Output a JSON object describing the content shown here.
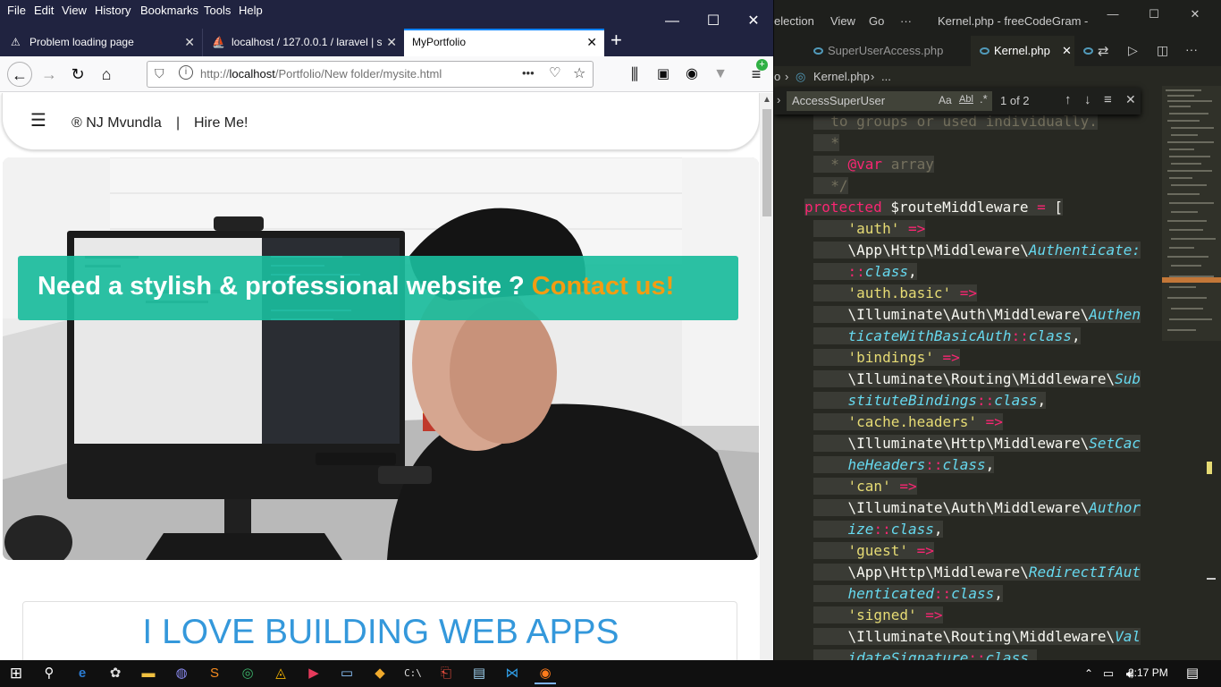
{
  "firefox": {
    "menu": [
      "File",
      "Edit",
      "View",
      "History",
      "Bookmarks",
      "Tools",
      "Help"
    ],
    "tabs": [
      {
        "label": "Problem loading page",
        "icon": "warning-icon"
      },
      {
        "label": "localhost / 127.0.0.1 / laravel | s",
        "icon": "phpmyadmin-icon"
      },
      {
        "label": "MyPortfolio",
        "active": true
      }
    ],
    "url_prefix": "http://",
    "url_host": "localhost",
    "url_path": "/Portfolio/New folder/mysite.html",
    "url_menu": "•••"
  },
  "site": {
    "brand": "® NJ Mvundla",
    "separator": "|",
    "hire": "Hire Me!",
    "banner_main": "Need a stylish & professional website ?",
    "banner_cta": "Contact us!",
    "heading": "I LOVE BUILDING WEB APPS"
  },
  "vscode": {
    "menu_partial": "election",
    "menu_view": "View",
    "menu_go": "Go",
    "menu_more": "···",
    "title": "Kernel.php - freeCodeGram - ...",
    "tabs": [
      {
        "label": "SuperUserAccess.php"
      },
      {
        "label": "Kernel.php",
        "active": true
      }
    ],
    "crumb_prefix": "o",
    "crumb_file": "Kernel.php",
    "crumb_more": "...",
    "find_query": "AccessSuperUser",
    "find_opt_case": "Aa",
    "find_opt_word": "Abl",
    "find_opt_regex": ".*",
    "find_count": "1 of 2",
    "code": [
      {
        "plain": "  to groups or used individually.",
        "cls": "c"
      },
      {
        "plain": "  *",
        "cls": "c"
      },
      {
        "plain": "  * ",
        "cls": "c",
        "kw": "@var",
        "rest": " array"
      },
      {
        "plain": "  */",
        "cls": "c"
      },
      {
        "kw": "protected",
        "rest": " $routeMiddleware",
        "op": " = ",
        "tail": "["
      },
      {
        "str": "    'auth'",
        "op": " =>"
      },
      {
        "ns": "    \\App\\Http\\Middleware\\",
        "it": "Authenticate:"
      },
      {
        "op2": "    ::",
        "cl": "class",
        "tail": ","
      },
      {
        "str": "    'auth.basic'",
        "op": " =>"
      },
      {
        "ns": "    \\Illuminate\\Auth\\Middleware\\",
        "it": "Authen"
      },
      {
        "it": "    ticateWithBasicAuth",
        "op2": "::",
        "cl": "class",
        "tail": ","
      },
      {
        "str": "    'bindings'",
        "op": " =>"
      },
      {
        "ns": "    \\Illuminate\\Routing\\Middleware\\",
        "it": "Sub"
      },
      {
        "it": "    stituteBindings",
        "op2": "::",
        "cl": "class",
        "tail": ","
      },
      {
        "str": "    'cache.headers'",
        "op": " =>"
      },
      {
        "ns": "    \\Illuminate\\Http\\Middleware\\",
        "it": "SetCac"
      },
      {
        "it": "    heHeaders",
        "op2": "::",
        "cl": "class",
        "tail": ","
      },
      {
        "str": "    'can'",
        "op": " =>"
      },
      {
        "ns": "    \\Illuminate\\Auth\\Middleware\\",
        "it": "Author"
      },
      {
        "it": "    ize",
        "op2": "::",
        "cl": "class",
        "tail": ","
      },
      {
        "str": "    'guest'",
        "op": " =>"
      },
      {
        "ns": "    \\App\\Http\\Middleware\\",
        "it": "RedirectIfAut"
      },
      {
        "it": "    henticated",
        "op2": "::",
        "cl": "class",
        "tail": ","
      },
      {
        "str": "    'signed'",
        "op": " =>"
      },
      {
        "ns": "    \\Illuminate\\Routing\\Middleware\\",
        "it": "Val"
      },
      {
        "it": "    idateSignature",
        "op2": "::",
        "cl": "class",
        "tail": ","
      }
    ]
  },
  "taskbar": {
    "time": "2:17 PM"
  },
  "colors": {
    "ff_chrome": "#202340",
    "accent": "#0a84ff",
    "banner": "#1abc9c",
    "cta": "#f39c12",
    "heading": "#3498db",
    "vs_bg": "#272822",
    "token_keyword": "#f92672",
    "token_string": "#e6db74",
    "token_class": "#66d9ef",
    "token_comment": "#75715e"
  }
}
